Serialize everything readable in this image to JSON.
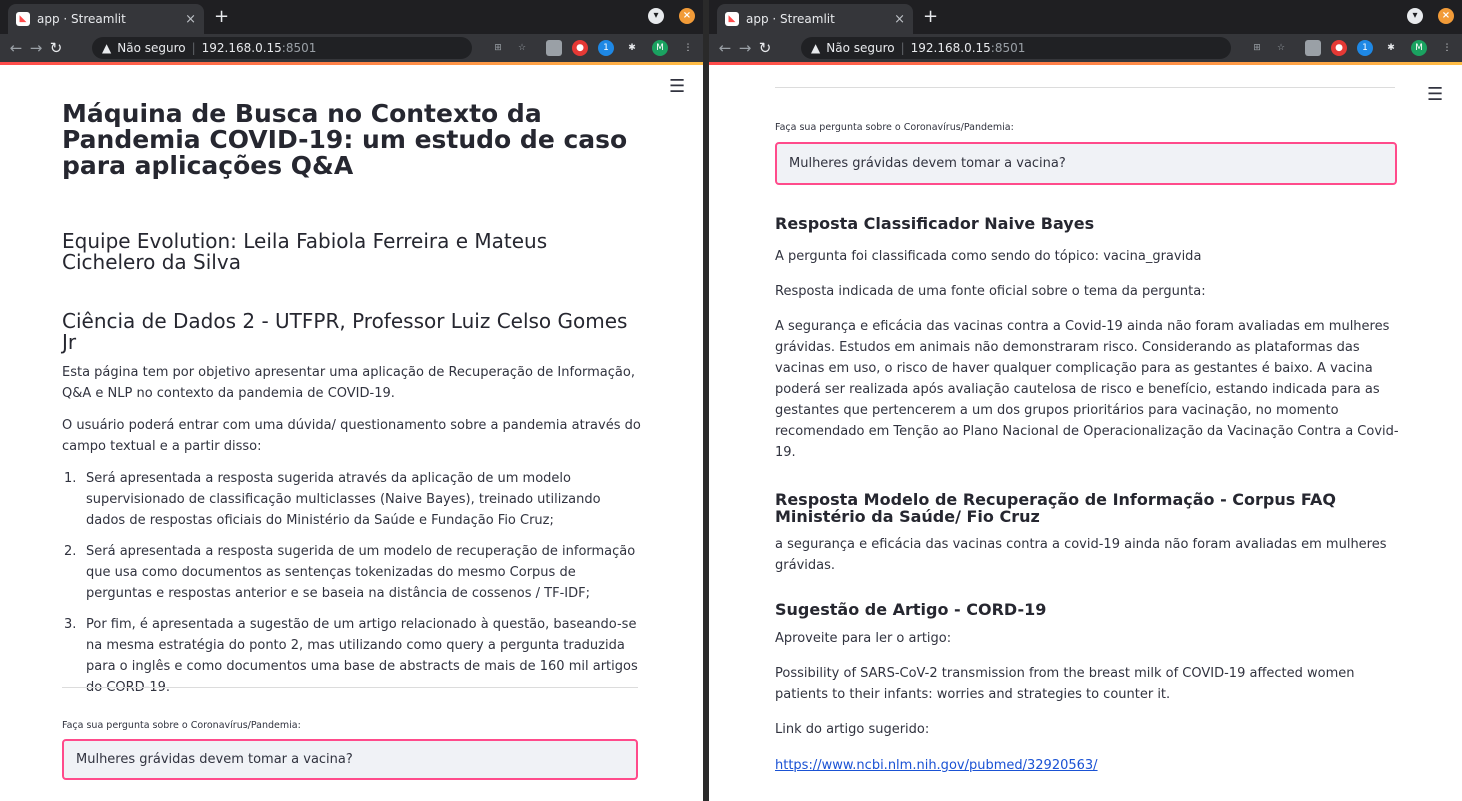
{
  "browser": {
    "tab_title": "app · Streamlit",
    "tab_close": "×",
    "new_tab": "+",
    "security_warning": "Não seguro",
    "host": "192.168.0.15",
    "port": ":8501",
    "profile_initial": "M",
    "ext_badge": "1"
  },
  "left": {
    "title": "Máquina de Busca no Contexto da Pandemia COVID-19: um estudo de caso para aplicações Q&A",
    "team": "Equipe Evolution: Leila Fabiola Ferreira e Mateus Cichelero da Silva",
    "course": "Ciência de Dados 2 - UTFPR, Professor Luiz Celso Gomes Jr",
    "intro1": "Esta página tem por objetivo apresentar uma aplicação de Recuperação de Informação, Q&A e NLP no contexto da pandemia de COVID-19.",
    "intro2": "O usuário poderá entrar com uma dúvida/ questionamento sobre a pandemia através do campo textual e a partir disso:",
    "list": [
      {
        "num": "1.",
        "text": "Será apresentada a resposta sugerida através da aplicação de um modelo supervisionado de classificação multiclasses (Naive Bayes), treinado utilizando dados de respostas oficiais do Ministério da Saúde e Fundação Fio Cruz;"
      },
      {
        "num": "2.",
        "text": "Será apresentada a resposta sugerida de um modelo de recuperação de informação que usa como documentos as sentenças tokenizadas do mesmo Corpus de perguntas e respostas anterior e se baseia na distância de cossenos / TF-IDF;"
      },
      {
        "num": "3.",
        "text": "Por fim, é apresentada a sugestão de um artigo relacionado à questão, baseando-se na mesma estratégia do ponto 2, mas utilizando como query a pergunta traduzida para o inglês e como documentos uma base de abstracts de mais de 160 mil artigos do CORD-19."
      }
    ],
    "input_label": "Faça sua pergunta sobre o Coronavírus/Pandemia:",
    "input_value": "Mulheres grávidas devem tomar a vacina?"
  },
  "right": {
    "input_label": "Faça sua pergunta sobre o Coronavírus/Pandemia:",
    "input_value": "Mulheres grávidas devem tomar a vacina?",
    "nb_heading": "Resposta Classificador Naive Bayes",
    "nb_topic": "A pergunta foi classificada como sendo do tópico: vacina_gravida",
    "nb_source": "Resposta indicada de uma fonte oficial sobre o tema da pergunta:",
    "nb_answer": "A segurança e eficácia das vacinas contra a Covid-19 ainda não foram avaliadas em mulheres grávidas. Estudos em animais não demonstraram risco. Considerando as plataformas das vacinas em uso, o risco de haver qualquer complicação para as gestantes é baixo. A vacina poderá ser realizada após avaliação cautelosa de risco e benefício, estando indicada para as gestantes que pertencerem a um dos grupos prioritários para vacinação, no momento recomendado em Tenção ao Plano Nacional de Operacionalização da Vacinação Contra a Covid-19.",
    "ir_heading": "Resposta Modelo de Recuperação de Informação - Corpus FAQ Ministério da Saúde/ Fio Cruz",
    "ir_answer": "a segurança e eficácia das vacinas contra a covid-19 ainda não foram avaliadas em mulheres grávidas.",
    "article_heading": "Sugestão de Artigo - CORD-19",
    "article_intro": "Aproveite para ler o artigo:",
    "article_title": "Possibility of SARS-CoV-2 transmission from the breast milk of COVID-19 affected women patients to their infants: worries and strategies to counter it.",
    "link_label": "Link do artigo sugerido:",
    "link_url": "https://www.ncbi.nlm.nih.gov/pubmed/32920563/"
  }
}
